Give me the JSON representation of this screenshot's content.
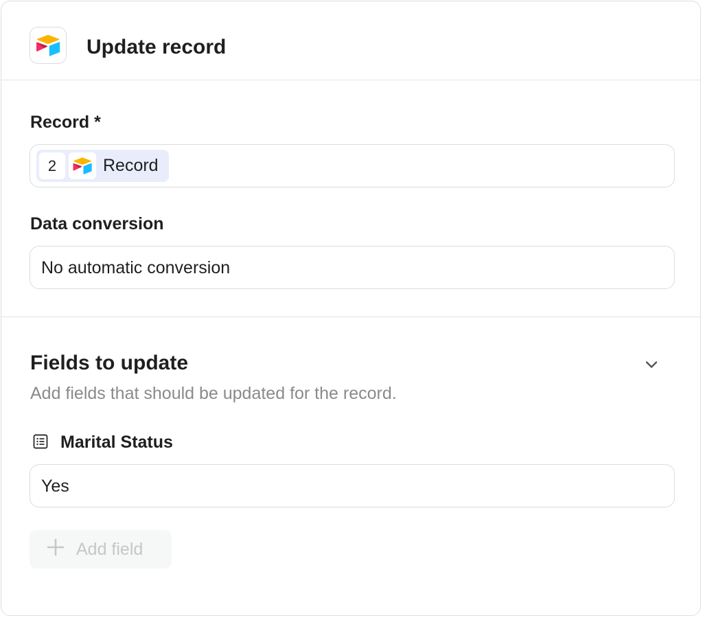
{
  "header": {
    "title": "Update record",
    "app_icon": "airtable-logo"
  },
  "record": {
    "label": "Record *",
    "chip_number": "2",
    "chip_label": "Record",
    "chip_icon": "airtable-logo"
  },
  "data_conversion": {
    "label": "Data conversion",
    "value": "No automatic conversion"
  },
  "fields_section": {
    "title": "Fields to update",
    "description": "Add fields that should be updated for the record.",
    "toggle_icon": "chevron-down-icon",
    "fields": [
      {
        "icon": "list-icon",
        "label": "Marital Status",
        "value": "Yes"
      }
    ],
    "add_label": "Add field"
  },
  "colors": {
    "chip_bg": "#e9edfb",
    "muted_text": "#8a8a8a",
    "disabled_text": "#c4c8c8",
    "border": "#dcdcdc"
  }
}
